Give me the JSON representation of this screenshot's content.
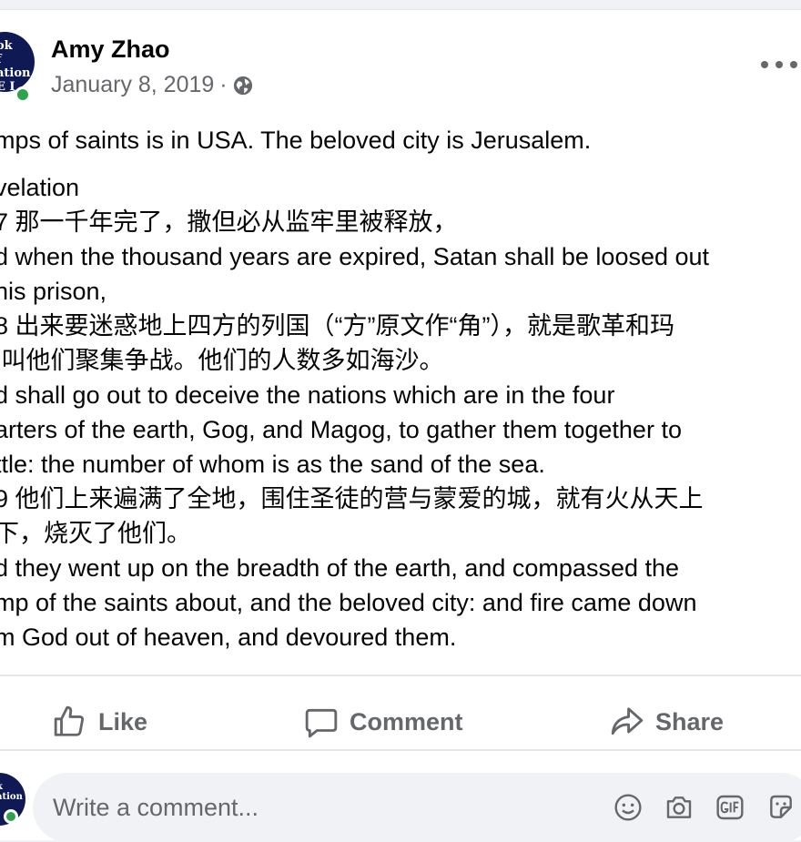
{
  "post": {
    "avatar_text": [
      "ok",
      "f",
      "ation",
      "E I"
    ],
    "author": "Amy Zhao",
    "date": "January 8, 2019",
    "separator": "·",
    "privacy_icon": "globe-icon",
    "more_icon": "more-options-icon",
    "intro": "mps of saints is in USA. The beloved city is Jerusalem.",
    "lines": [
      "velation",
      "7 那一千年完了，撒但必从监牢里被释放，",
      "d when the thousand years are expired, Satan shall be loosed out",
      "his prison,",
      "8 出来要迷惑地上四方的列国（“方”原文作“角”），就是歌革和玛",
      " 叫他们聚集争战。他们的人数多如海沙。",
      "d shall go out to deceive the nations which are in the four",
      "arters of the earth, Gog, and Magog, to gather them together to",
      "ttle: the number of whom is as the sand of the sea.",
      "9 他们上来遍满了全地，围住圣徒的营与蒙爱的城，就有火从天上",
      "下，烧灭了他们。",
      "d they went up on the breadth of the earth, and compassed the",
      "mp of the saints about, and the beloved city: and fire came down",
      "m God out of heaven, and devoured them."
    ]
  },
  "actions": {
    "like": "Like",
    "comment": "Comment",
    "share": "Share"
  },
  "comment_box": {
    "avatar_text": [
      "k",
      "ation"
    ],
    "placeholder": "Write a comment...",
    "icons": [
      "emoji-icon",
      "camera-icon",
      "gif-icon",
      "sticker-icon"
    ]
  },
  "colors": {
    "secondary_text": "#65676b",
    "online_dot": "#31a24c",
    "avatar_bg": "#0f1a55"
  }
}
